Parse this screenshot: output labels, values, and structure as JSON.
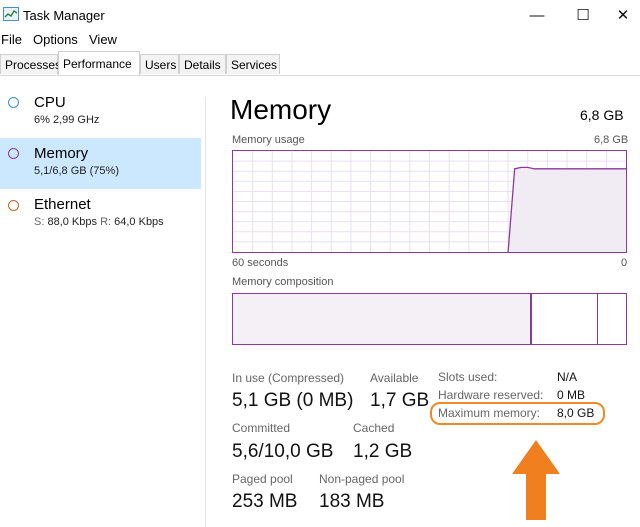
{
  "window": {
    "title": "Task Manager",
    "controls": {
      "minimize": "—",
      "maximize": "☐",
      "close": "✕"
    }
  },
  "menu": [
    "File",
    "Options",
    "View"
  ],
  "tabs": [
    "Processes",
    "Performance",
    "Users",
    "Details",
    "Services"
  ],
  "active_tab": "Performance",
  "sidebar": {
    "items": [
      {
        "title": "CPU",
        "sub": "6%  2,99 GHz",
        "color": "#3d8fd1"
      },
      {
        "title": "Memory",
        "sub": "5,1/6,8 GB (75%)",
        "color": "#8b3a9b",
        "selected": true
      },
      {
        "title": "Ethernet",
        "sub_s_label": "S:",
        "sub_s": "88,0 Kbps",
        "sub_r_label": "R:",
        "sub_r": "64,0 Kbps",
        "color": "#c2672a"
      }
    ]
  },
  "main": {
    "title": "Memory",
    "total": "6,8 GB",
    "usage_chart": {
      "label": "Memory usage",
      "max_label": "6,8 GB",
      "time_label": "60 seconds",
      "min_label": "0"
    },
    "composition": {
      "label": "Memory composition"
    },
    "stats": {
      "in_use_label": "In use (Compressed)",
      "in_use": "5,1 GB (0 MB)",
      "available_label": "Available",
      "available": "1,7 GB",
      "committed_label": "Committed",
      "committed": "5,6/10,0 GB",
      "cached_label": "Cached",
      "cached": "1,2 GB",
      "paged_label": "Paged pool",
      "paged": "253 MB",
      "nonpaged_label": "Non-paged pool",
      "nonpaged": "183 MB"
    },
    "details": {
      "slots_label": "Slots used:",
      "slots": "N/A",
      "hw_label": "Hardware reserved:",
      "hw": "0 MB",
      "max_label": "Maximum memory:",
      "max": "8,0 GB"
    }
  },
  "colors": {
    "accent": "#8b3a9b",
    "selection": "#cce8ff",
    "highlight": "#f08a28",
    "arrow": "#f07f20"
  },
  "chart_data": {
    "type": "area",
    "x": [
      60,
      55,
      50,
      45,
      40,
      35,
      30,
      25,
      20,
      18,
      17,
      16,
      15,
      14,
      12,
      10,
      5,
      0
    ],
    "values": [
      null,
      null,
      null,
      null,
      null,
      null,
      null,
      null,
      null,
      0,
      5.6,
      5.7,
      5.7,
      5.6,
      5.6,
      5.6,
      5.6,
      5.6
    ],
    "xlim": [
      60,
      0
    ],
    "ylim": [
      0,
      6.8
    ],
    "grid": true
  }
}
